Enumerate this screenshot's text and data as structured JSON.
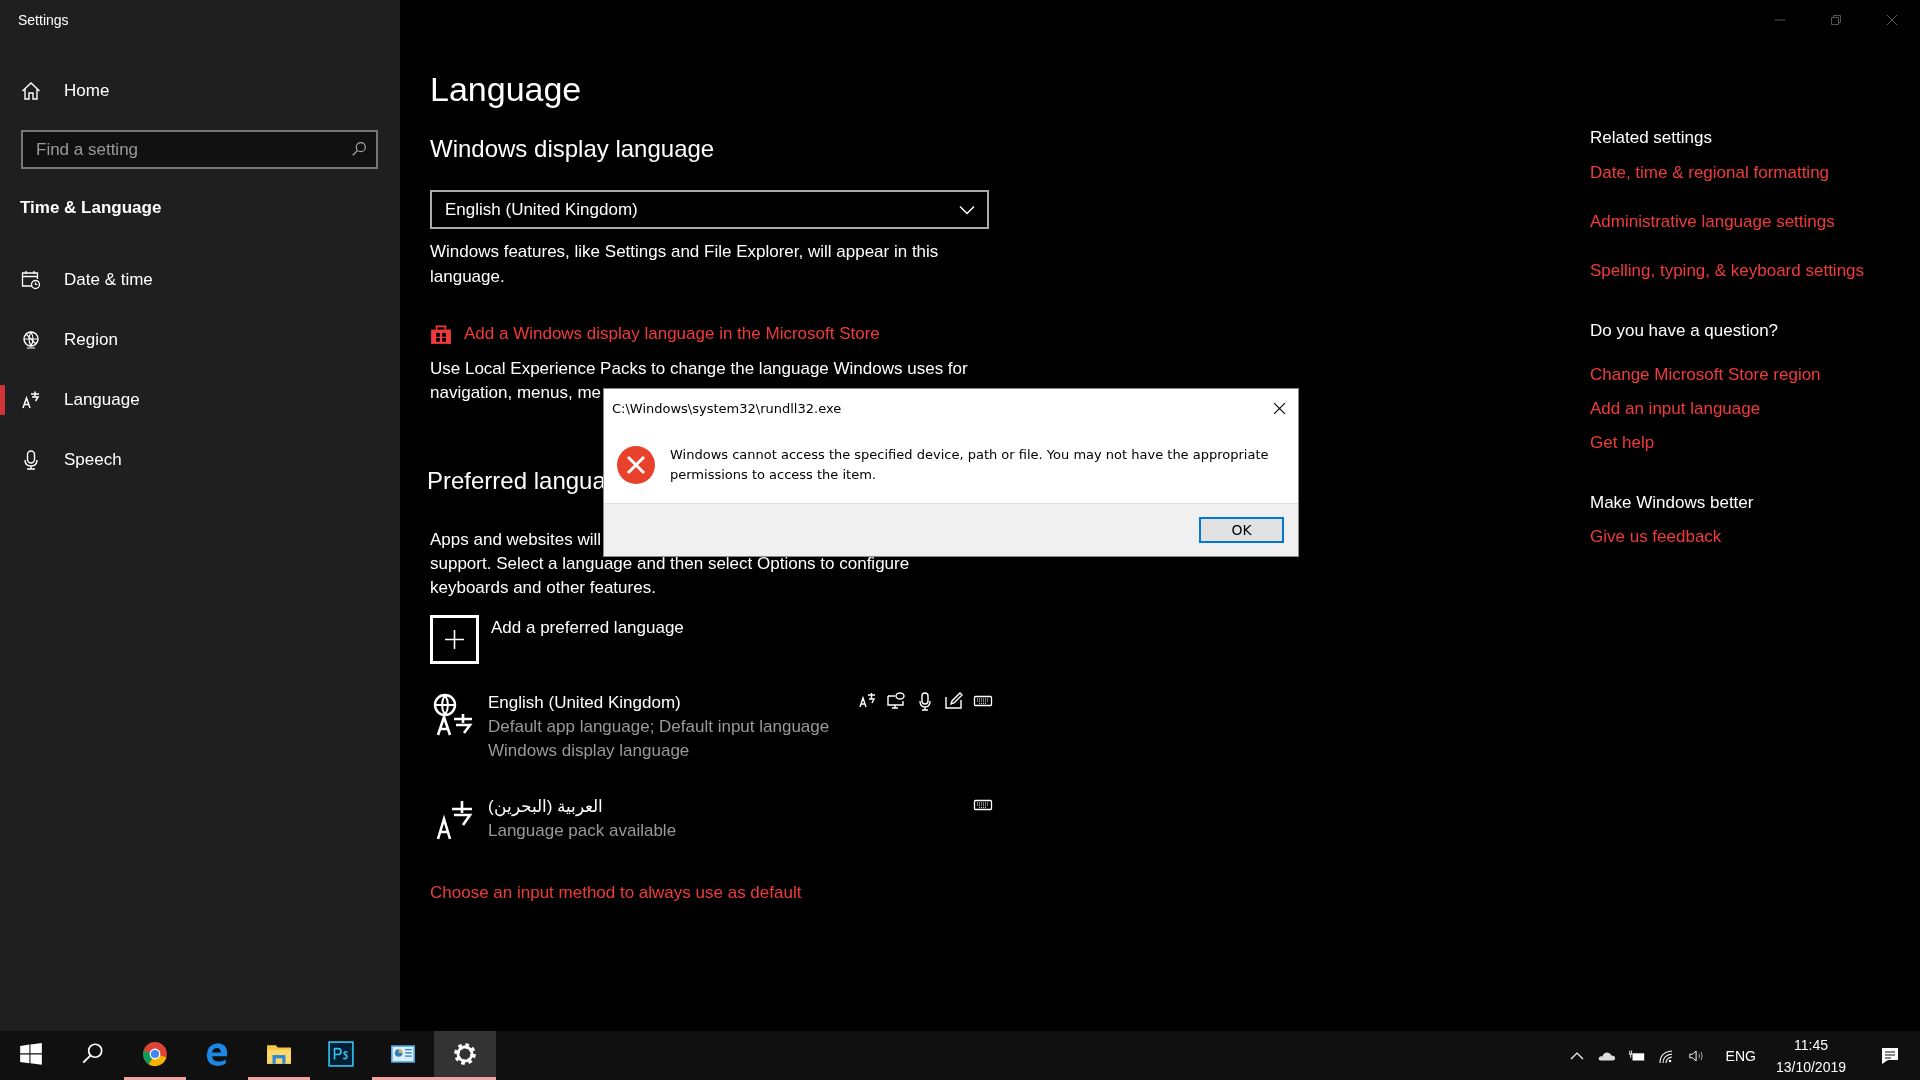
{
  "window": {
    "title": "Settings"
  },
  "sidebar": {
    "home": "Home",
    "search": {
      "placeholder": "Find a setting"
    },
    "section": "Time & Language",
    "items": [
      {
        "label": "Date & time",
        "selected": false
      },
      {
        "label": "Region",
        "selected": false
      },
      {
        "label": "Language",
        "selected": true
      },
      {
        "label": "Speech",
        "selected": false
      }
    ]
  },
  "page": {
    "title": "Language",
    "display_heading": "Windows display language",
    "display_value": "English (United Kingdom)",
    "display_note": "Windows features, like Settings and File Explorer, will appear in this language.",
    "store_link": "Add a Windows display language in the Microsoft Store",
    "packs_lines": [
      "Use Local Experience Packs to change the language Windows uses for",
      "navigation, menus, me"
    ],
    "preferred_heading": "Preferred langua",
    "preferred_lines": [
      "Apps and websites will",
      "support. Select a language and then select Options to configure",
      "keyboards and other features."
    ],
    "add_language": "Add a preferred language",
    "languages": [
      {
        "name": "English (United Kingdom)",
        "details": [
          "Default app language; Default input language",
          "Windows display language"
        ]
      },
      {
        "name": "العربية (البحرين)",
        "details": [
          "Language pack available"
        ]
      }
    ],
    "input_link": "Choose an input method to always use as default"
  },
  "related": [
    {
      "heading": "Related settings",
      "links": [
        "Date, time & regional formatting",
        "Administrative language settings",
        "Spelling, typing, & keyboard settings"
      ]
    },
    {
      "heading": "Do you have a question?",
      "links": [
        "Change Microsoft Store region",
        "Add an input language",
        "Get help"
      ]
    },
    {
      "heading": "Make Windows better",
      "links": [
        "Give us feedback"
      ]
    }
  ],
  "dialog": {
    "title": "C:\\Windows\\system32\\rundll32.exe",
    "message": "Windows cannot access the specified device, path or file. You may not have the appropriate permissions to access the item.",
    "button": "OK"
  },
  "taskbar": {
    "apps": [
      {
        "kind": "start",
        "running": false,
        "active": false
      },
      {
        "kind": "search",
        "running": false,
        "active": false
      },
      {
        "kind": "chrome",
        "running": true,
        "active": false
      },
      {
        "kind": "edge",
        "running": false,
        "active": false
      },
      {
        "kind": "explorer",
        "running": true,
        "active": false
      },
      {
        "kind": "photoshop",
        "running": false,
        "active": false
      },
      {
        "kind": "control-panel",
        "running": true,
        "active": false
      },
      {
        "kind": "settings",
        "running": true,
        "active": true
      }
    ],
    "language": "ENG",
    "time": "11:45",
    "date": "13/10/2019"
  }
}
